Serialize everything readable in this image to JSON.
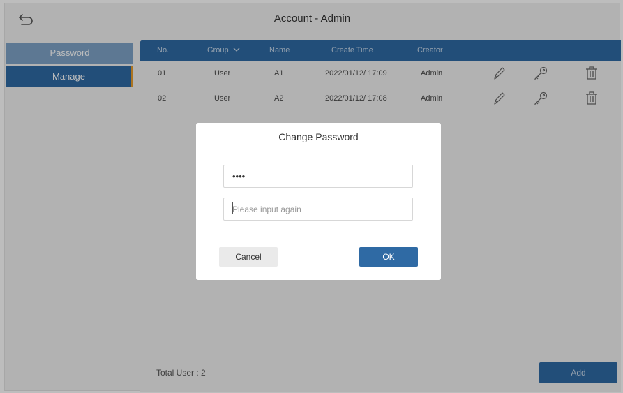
{
  "header": {
    "title": "Account - Admin",
    "back_icon": "back-arrow-icon"
  },
  "sidebar": {
    "items": [
      {
        "label": "Password"
      },
      {
        "label": "Manage"
      }
    ]
  },
  "table": {
    "columns": [
      "No.",
      "Group",
      "Name",
      "Create Time",
      "Creator"
    ],
    "group_icon": "chevron-down-icon",
    "rows": [
      {
        "no": "01",
        "group": "User",
        "name": "A1",
        "create_time": "2022/01/12/ 17:09",
        "creator": "Admin"
      },
      {
        "no": "02",
        "group": "User",
        "name": "A2",
        "create_time": "2022/01/12/ 17:08",
        "creator": "Admin"
      }
    ],
    "row_icons": [
      "pencil-icon",
      "key-icon",
      "trash-icon"
    ]
  },
  "footer": {
    "total_label": "Total User : 2",
    "add_label": "Add"
  },
  "dialog": {
    "title": "Change Password",
    "password_value": "••••",
    "confirm_placeholder": "Please input again",
    "cancel_label": "Cancel",
    "ok_label": "OK"
  },
  "colors": {
    "primary": "#2f6aa4",
    "sidebar_light": "#7ea3c7",
    "accent": "#e89d2c",
    "background": "#f0f0f0"
  }
}
